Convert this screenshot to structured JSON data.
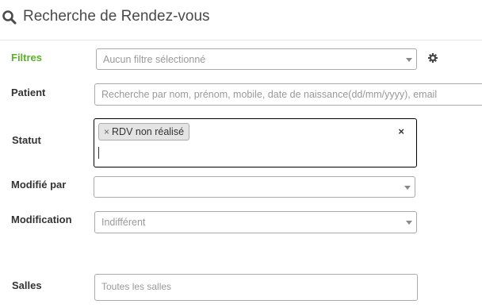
{
  "header": {
    "title": "Recherche de Rendez-vous"
  },
  "filters": {
    "filtres_label": "Filtres",
    "filtres_value": "Aucun filtre sélectionné",
    "patient_label": "Patient",
    "patient_placeholder": "Recherche par nom, prénom, mobile, date de naissance(dd/mm/yyyy), email",
    "statut_label": "Statut",
    "statut_tags": [
      "RDV non réalisé"
    ],
    "tag_remove_symbol": "×",
    "clear_symbol": "×",
    "modifie_par_label": "Modifié par",
    "modifie_par_value": "",
    "modification_label": "Modification",
    "modification_value": "Indifférent",
    "salles_label": "Salles",
    "salles_placeholder": "Toutes les salles"
  },
  "colors": {
    "accent_green": "#5ab025",
    "border": "#aaaaaa",
    "placeholder": "#999999"
  },
  "icons": {
    "header": "search-icon",
    "filter_settings": "gear-icon",
    "dropdown": "chevron-down-icon"
  }
}
